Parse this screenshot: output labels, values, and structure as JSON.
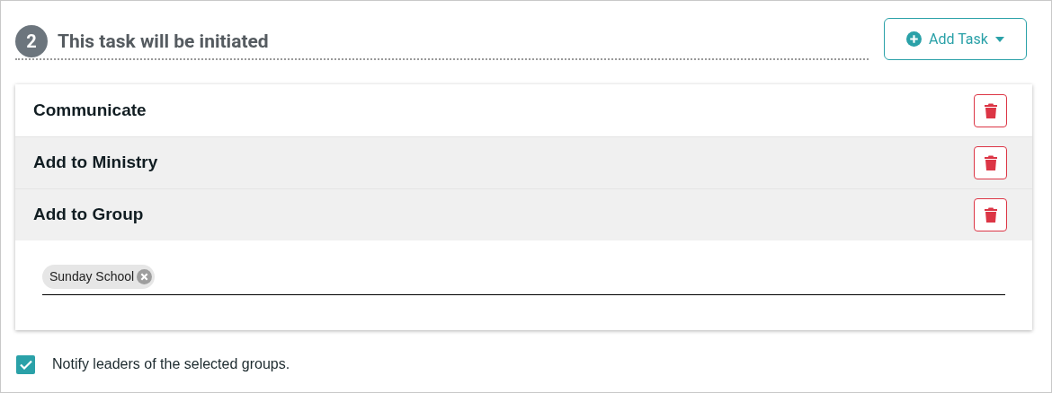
{
  "step": {
    "number": "2",
    "title": "This task will be initiated"
  },
  "add_button": {
    "label": "Add Task"
  },
  "tasks": [
    {
      "name": "Communicate",
      "highlighted": false
    },
    {
      "name": "Add to Ministry",
      "highlighted": true
    },
    {
      "name": "Add to Group",
      "highlighted": true,
      "chips": [
        "Sunday School"
      ]
    }
  ],
  "notify": {
    "label": "Notify leaders of the selected groups.",
    "checked": true
  }
}
